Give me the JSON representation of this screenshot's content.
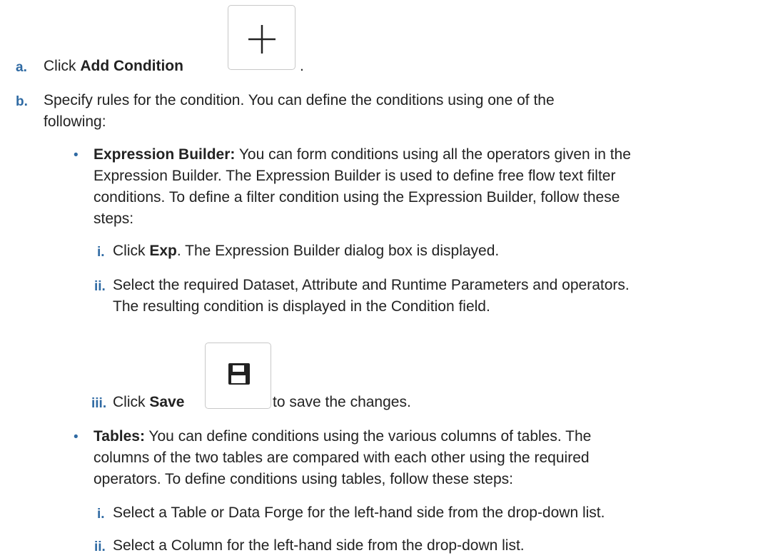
{
  "steps": {
    "a": {
      "marker": "a.",
      "pre": "Click ",
      "bold": "Add Condition",
      "post": ".",
      "icon": "plus-icon"
    },
    "b": {
      "marker": "b.",
      "line1": "Specify rules for the condition. You can define the conditions using one of the",
      "line2": "following:"
    }
  },
  "expression_builder": {
    "bullet": "•",
    "bold": "Expression Builder:",
    "line1": " You can form conditions using all the operators given in the",
    "line2": "Expression Builder. The Expression Builder is used to define free flow text filter",
    "line3": "conditions. To define a filter condition using the Expression Builder, follow these",
    "line4": "steps:",
    "substeps": [
      {
        "marker": "i.",
        "pre": "Click ",
        "bold": "Exp",
        "post": ". The Expression Builder dialog box is displayed."
      },
      {
        "marker": "ii.",
        "line1": "Select the required Dataset, Attribute and Runtime Parameters and operators.",
        "line2": "The resulting condition is displayed in the Condition field."
      },
      {
        "marker": "iii.",
        "pre": "Click ",
        "bold": "Save",
        "post": " to save the changes.",
        "icon": "save-icon"
      }
    ]
  },
  "tables": {
    "bullet": "•",
    "bold": "Tables:",
    "line1": " You can define conditions using the various columns of tables. The",
    "line2": "columns of the two tables are compared with each other using the required",
    "line3": "operators. To define conditions using tables, follow these steps:",
    "substeps": [
      {
        "marker": "i.",
        "text": "Select a Table or Data Forge for the left-hand side from the drop-down list."
      },
      {
        "marker": "ii.",
        "text": "Select a Column for the left-hand side from the drop-down list."
      }
    ]
  }
}
